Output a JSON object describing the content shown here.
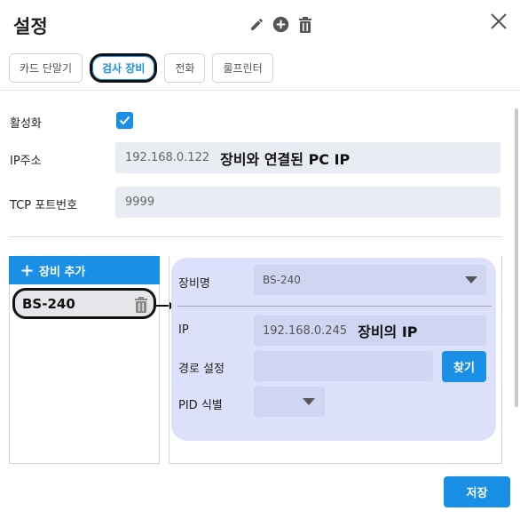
{
  "window": {
    "title": "설정"
  },
  "header_icons": [
    "pencil-icon",
    "add-circle-icon",
    "trash-icon"
  ],
  "tabs": [
    {
      "label": "카드 단말기",
      "active": false
    },
    {
      "label": "검사 장비",
      "active": true
    },
    {
      "label": "전화",
      "active": false
    },
    {
      "label": "룰프린터",
      "active": false
    }
  ],
  "general": {
    "enabled_label": "활성화",
    "enabled": true,
    "ip_label": "IP주소",
    "ip_value": "192.168.0.122",
    "ip_annotation": "장비와 연결된 PC IP",
    "port_label": "TCP 포트번호",
    "port_value": "9999"
  },
  "devices": {
    "add_label": "장비 추가",
    "items": [
      {
        "name": "BS-240"
      }
    ]
  },
  "detail": {
    "name_label": "장비명",
    "name_value": "BS-240",
    "ip_label": "IP",
    "ip_value": "192.168.0.245",
    "ip_annotation": "장비의 IP",
    "path_label": "경로 설정",
    "path_value": "",
    "find_label": "찾기",
    "pid_label": "PID 식별",
    "pid_value": ""
  },
  "footer": {
    "save_label": "저장"
  },
  "colors": {
    "accent": "#1a8fe6",
    "detail_bg": "#dce0fa",
    "field_bg": "#e9ecf2"
  }
}
